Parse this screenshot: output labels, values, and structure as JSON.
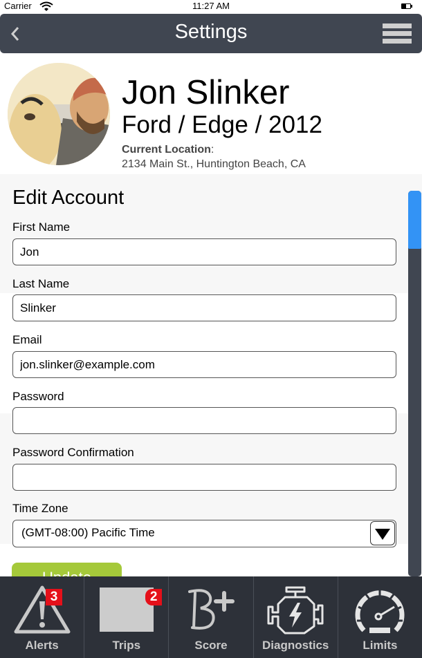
{
  "status_bar": {
    "carrier": "Carrier",
    "time": "11:27 AM"
  },
  "nav": {
    "title": "Settings",
    "back_icon": "chevron-left-icon",
    "menu_icon": "hamburger-menu-icon"
  },
  "profile": {
    "name": "Jon Slinker",
    "vehicle": "Ford / Edge / 2012",
    "location_label": "Current Location",
    "location_sep": ":",
    "location_value": "2134 Main St., Huntington Beach, CA"
  },
  "form": {
    "title": "Edit Account",
    "fields": [
      {
        "label": "First Name",
        "value": "Jon",
        "type": "text"
      },
      {
        "label": "Last Name",
        "value": "Slinker",
        "type": "text"
      },
      {
        "label": "Email",
        "value": "jon.slinker@example.com",
        "type": "email"
      },
      {
        "label": "Password",
        "value": "",
        "type": "password"
      },
      {
        "label": "Password Confirmation",
        "value": "",
        "type": "password"
      }
    ],
    "timezone": {
      "label": "Time Zone",
      "selected": "(GMT-08:00) Pacific Time"
    },
    "submit_label": "Update"
  },
  "scrollbar": {
    "position_fraction": 0.0
  },
  "tabs": [
    {
      "label": "Alerts",
      "icon": "warning-triangle-icon",
      "badge": "3"
    },
    {
      "label": "Trips",
      "icon": "trips-placeholder-icon",
      "badge": "2"
    },
    {
      "label": "Score",
      "icon": "grade-b-plus-icon",
      "badge": null
    },
    {
      "label": "Diagnostics",
      "icon": "engine-icon",
      "badge": null
    },
    {
      "label": "Limits",
      "icon": "speedometer-icon",
      "badge": null
    }
  ],
  "colors": {
    "nav_bg": "#404651",
    "tab_bar_bg": "#2d3139",
    "accent_green": "#a5c93a",
    "scroll_thumb": "#3393f5",
    "badge_red": "#e5101a"
  }
}
